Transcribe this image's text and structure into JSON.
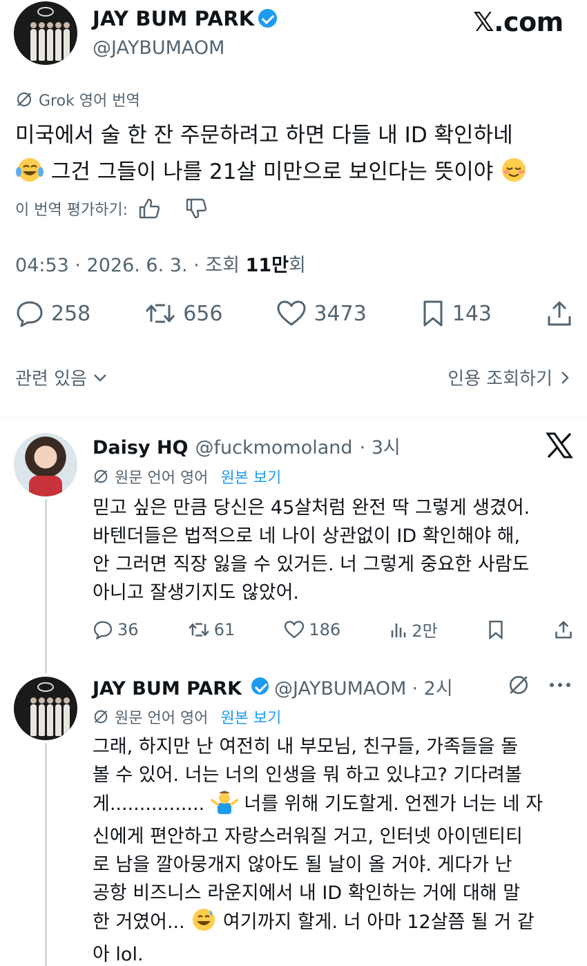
{
  "header": {
    "display_name": "JAY BUM PARK",
    "handle": "@JAYBUMAOM",
    "site_mark": "𝕏.com"
  },
  "tweet": {
    "translate_label": "Grok 영어 번역",
    "text_line1": "미국에서 술 한 잔 주문하려고 하면 다들 내 ID 확인하네",
    "text_line2": "그건 그들이 나를 21살 미만으로 보인다는 뜻이야",
    "rate_label": "이 번역 평가하기:",
    "meta_prefix": "04:53 · 2026. 6. 3. · 조회 ",
    "views_bold": "11만",
    "meta_suffix": "회",
    "replies": "258",
    "reposts": "656",
    "likes": "3473",
    "bookmarks": "143",
    "related_label": "관련 있음",
    "quote_views_label": "인용 조회하기"
  },
  "reply1": {
    "display_name": "Daisy HQ",
    "handle": "@fuckmomoland",
    "time": "· 3시",
    "lang_label": "원문 언어 영어",
    "original_link": "원본 보기",
    "lines": [
      "믿고 싶은 만큼 당신은 45살처럼 완전 딱 그렇게 생겼어.",
      "바텐더들은 법적으로 네 나이 상관없이 ID 확인해야 해,",
      "안 그러면 직장 잃을 수 있거든. 너 그렇게 중요한 사람도",
      "아니고 잘생기지도 않았어."
    ],
    "replies": "36",
    "reposts": "61",
    "likes": "186",
    "views": "2만"
  },
  "reply2": {
    "display_name": "JAY BUM PARK",
    "handle": "@JAYBUMAOM",
    "time": "· 2시",
    "lang_label": "원문 언어 영어",
    "original_link": "원본 보기",
    "line1": "그래, 하지만 난 여전히 내 부모님, 친구들, 가족들을 돌",
    "line2": "볼 수 있어. 너는 너의 인생을 뭐 하고 있냐고? 기다려볼",
    "line3a": "게................",
    "line3b": " 너를 위해 기도할게. 언젠가 너는 네 자",
    "line4": "신에게 편안하고 자랑스러워질 거고, 인터넷 아이덴티티",
    "line5": "로 남을 깔아뭉개지 않아도 될 날이 올 거야. 게다가 난",
    "line6": "공항 비즈니스 라운지에서 내 ID 확인하는 거에 대해 말",
    "line7a": "한 거였어...",
    "line7b": " 여기까지 할게. 너 아마 12살쯤 될 거 같",
    "line8": "아 lol."
  },
  "icons": [
    "grok-icon",
    "thumbs-up-icon",
    "thumbs-down-icon",
    "reply-icon",
    "repost-icon",
    "like-icon",
    "bookmark-icon",
    "share-icon",
    "views-icon",
    "chevron-down-icon",
    "chevron-right-icon",
    "x-logo-icon",
    "more-icon",
    "verified-badge-icon"
  ],
  "colors": {
    "accent": "#1d9bf0",
    "muted": "#536471",
    "text": "#0f1419"
  }
}
